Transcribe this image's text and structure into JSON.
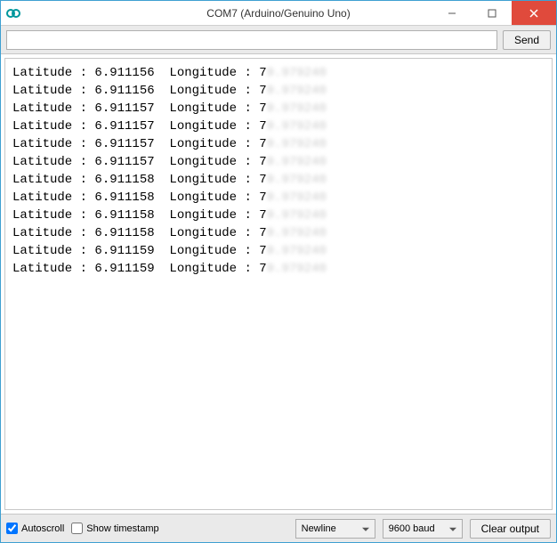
{
  "window": {
    "title": "COM7 (Arduino/Genuino Uno)"
  },
  "toolbar": {
    "input_value": "",
    "send_label": "Send"
  },
  "output": {
    "label_latitude": "Latitude",
    "label_longitude": "Longitude",
    "lines": [
      {
        "lat": "6.911156",
        "lon_prefix": "7",
        "lon_blurred": "9.979240"
      },
      {
        "lat": "6.911156",
        "lon_prefix": "7",
        "lon_blurred": "9.979240"
      },
      {
        "lat": "6.911157",
        "lon_prefix": "7",
        "lon_blurred": "9.979240"
      },
      {
        "lat": "6.911157",
        "lon_prefix": "7",
        "lon_blurred": "9.979240"
      },
      {
        "lat": "6.911157",
        "lon_prefix": "7",
        "lon_blurred": "9.979240"
      },
      {
        "lat": "6.911157",
        "lon_prefix": "7",
        "lon_blurred": "9.979240"
      },
      {
        "lat": "6.911158",
        "lon_prefix": "7",
        "lon_blurred": "9.979240"
      },
      {
        "lat": "6.911158",
        "lon_prefix": "7",
        "lon_blurred": "9.979240"
      },
      {
        "lat": "6.911158",
        "lon_prefix": "7",
        "lon_blurred": "9.979240"
      },
      {
        "lat": "6.911158",
        "lon_prefix": "7",
        "lon_blurred": "9.979240"
      },
      {
        "lat": "6.911159",
        "lon_prefix": "7",
        "lon_blurred": "9.979240"
      },
      {
        "lat": "6.911159",
        "lon_prefix": "7",
        "lon_blurred": "9.979240"
      }
    ]
  },
  "statusbar": {
    "autoscroll_label": "Autoscroll",
    "autoscroll_checked": true,
    "timestamp_label": "Show timestamp",
    "timestamp_checked": false,
    "line_ending": "Newline",
    "baud": "9600 baud",
    "clear_label": "Clear output"
  }
}
